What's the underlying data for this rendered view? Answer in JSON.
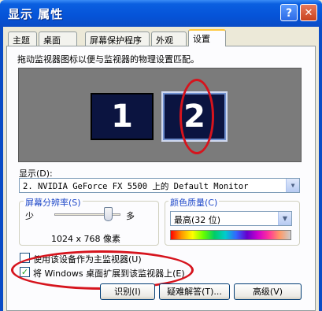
{
  "window": {
    "title": "显示 属性"
  },
  "titlebar_buttons": {
    "help": "?",
    "close": "✕"
  },
  "tabs": [
    {
      "label": "主题"
    },
    {
      "label": "桌面"
    },
    {
      "label": "屏幕保护程序"
    },
    {
      "label": "外观"
    },
    {
      "label": "设置"
    }
  ],
  "settings": {
    "hint": "拖动监视器图标以便与监视器的物理设置匹配。",
    "monitors": [
      {
        "label": "1"
      },
      {
        "label": "2"
      }
    ],
    "display_label": "显示(D):",
    "display_value": "2. NVIDIA GeForce FX 5500 上的 Default Monitor",
    "resolution": {
      "title": "屏幕分辨率(S)",
      "min_label": "少",
      "max_label": "多",
      "value": "1024 x 768 像素",
      "level": 0.75
    },
    "color_quality": {
      "title": "颜色质量(C)",
      "value": "最高(32 位)"
    },
    "checkbox_primary": {
      "label": "使用该设备作为主监视器(U)",
      "checked": false
    },
    "checkbox_extend": {
      "label": "将 Windows 桌面扩展到该监视器上(E)",
      "checked": true
    }
  },
  "buttons": {
    "identify": "识别(I)",
    "troubleshoot": "疑难解答(T)...",
    "advanced": "高级(V)"
  },
  "annotation_color": "#d6141d"
}
